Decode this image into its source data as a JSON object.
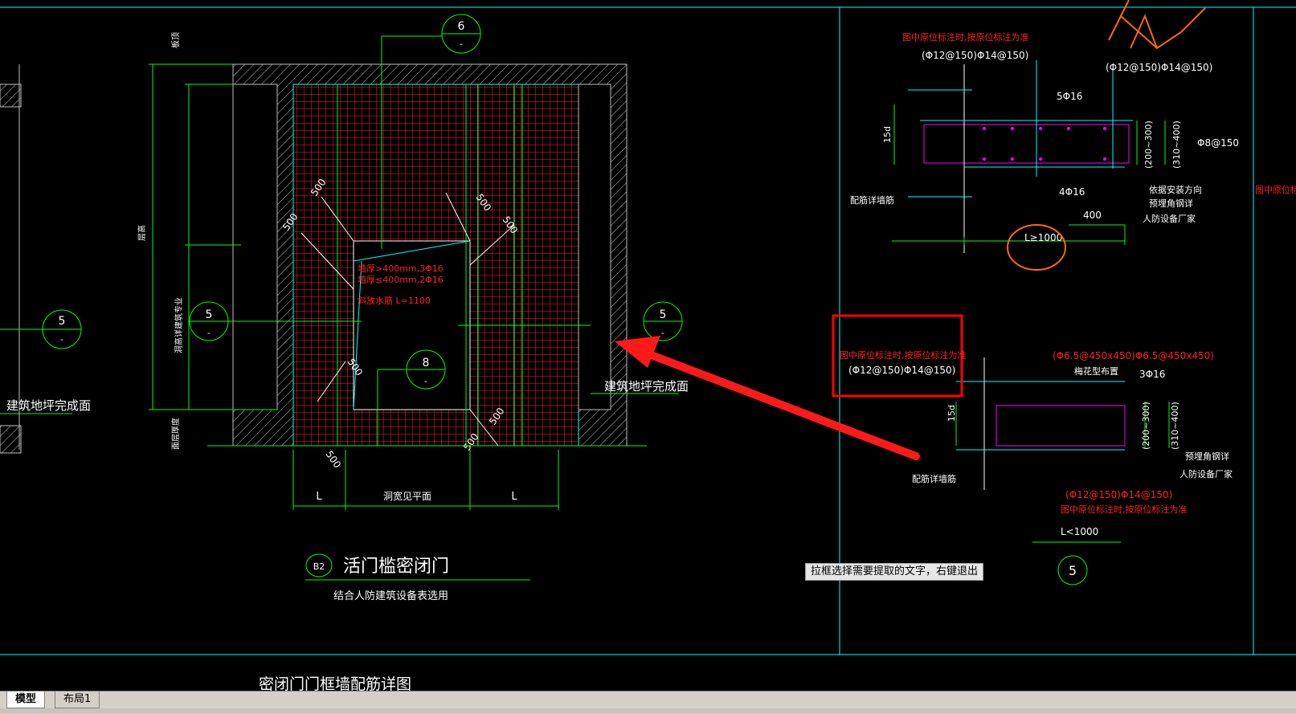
{
  "colors": {
    "background": "#000000",
    "structure": "#00ff00",
    "outline": "#00ffff",
    "rebar": "#ff2020",
    "embed": "#ff00ff",
    "text": "#ffffff",
    "highlight": "#ff0000",
    "freehand": "#ff6a00"
  },
  "icons": {
    "arrow": "red-arrow-annotation",
    "scribble": "orange-scribble-mark"
  },
  "drawing": {
    "left_edge_texts": {
      "finish_floor": "建筑地坪完成面",
      "callout_number": "5",
      "callout_dash": "-"
    },
    "main": {
      "callout_top": {
        "num": "6",
        "dash": "-"
      },
      "callout_left": {
        "num": "5",
        "dash": "-"
      },
      "callout_right": {
        "num": "5",
        "dash": "-"
      },
      "callout_inner": {
        "num": "8",
        "dash": "-"
      },
      "opening_note_1": "墙厚>400mm,3Φ16",
      "opening_note_2": "墙厚≤400mm,2Φ16",
      "opening_note_3": "斜放水筋 L=1100",
      "dim_500": "500",
      "dim_L": "L",
      "opening_width": "洞宽见平面",
      "finish_floor": "建筑地坪完成面",
      "vertical_label_1": "板顶",
      "vertical_label_2": "层高",
      "vertical_label_3": "洞高详建筑专业",
      "vertical_label_4": "面层厚度"
    },
    "title_block": {
      "badge": "B2",
      "title": "活门槛密闭门",
      "subtitle": "结合人防建筑设备表选用",
      "bottom_title": "密闭门门框墙配筋详图"
    },
    "detail_top": {
      "red_note": "图中原位标注时,按原位标注为准",
      "rebar_1": "(Φ12@150)Φ14@150)",
      "rebar_2": "(Φ12@150)Φ14@150)",
      "bars_top": "5Φ16",
      "bars_bottom": "4Φ16",
      "dim_15d": "15d",
      "dim_200": "(200~300)",
      "dim_310": "(310~400)",
      "stirrup": "Φ8@150",
      "note_direction": "依据安装方向",
      "note_embed": "预埋角钢详",
      "note_vendor": "人防设备厂家",
      "dim_400": "400",
      "dim_L": "L≥1000",
      "wall_note": "配筋详墙筋"
    },
    "detail_bottom": {
      "red_note": "图中原位标注时,按原位标注为准",
      "rebar_1": "(Φ12@150)Φ14@150)",
      "rebar_tie": "(Φ6.5@450x450)Φ6.5@450x450)",
      "tie_label": "梅花型布置",
      "bars": "3Φ16",
      "dim_15d": "15d",
      "dim_200": "(200~300)",
      "dim_310": "(310~400)",
      "note_embed": "预埋角钢详",
      "note_vendor": "人防设备厂家",
      "rebar_2": "(Φ12@150)Φ14@150)",
      "red_note_2": "图中原位标注时,按原位标注为准",
      "dim_L": "L<1000",
      "wall_note": "配筋详墙筋",
      "callout_number": "5"
    },
    "right_edge_note": "图中原位标注"
  },
  "tooltip": "拉框选择需要提取的文字，右键退出",
  "tabs": [
    {
      "label": "模型",
      "active": true
    },
    {
      "label": "布局1",
      "active": false
    }
  ]
}
